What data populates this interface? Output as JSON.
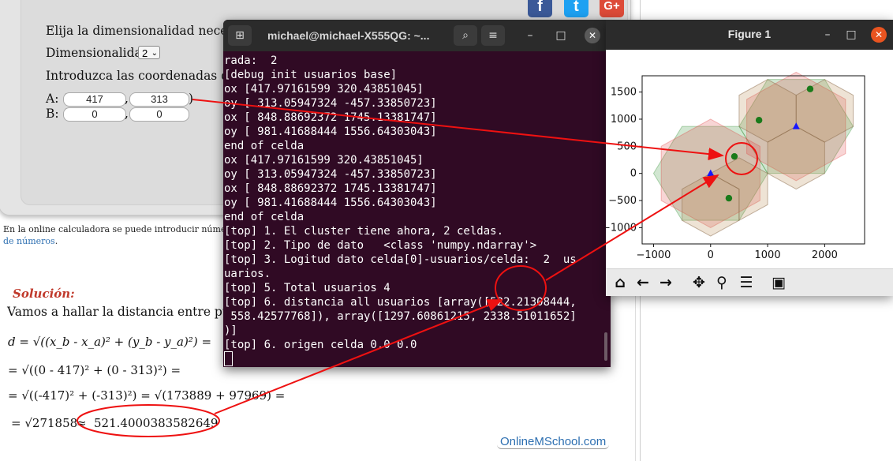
{
  "calculator": {
    "prompt_dimension": "Elija la dimensionalidad necesaria:",
    "dimension_label": "Dimensionalidad:",
    "dimension_value": "2",
    "coords_prompt": "Introduzca las coordenadas de punt",
    "point_a_label": "A: (",
    "point_b_label": "B: (",
    "comma": ",",
    "close_paren": ")",
    "a": [
      "417",
      "313"
    ],
    "b": [
      "0",
      "0"
    ]
  },
  "note": {
    "line1": "En la online calculadora se puede introducir números c",
    "line2": "de números",
    "line2_end": "."
  },
  "social": {
    "facebook": "f",
    "twitter": "t",
    "google": "G+"
  },
  "solution": {
    "title": "Solución:",
    "intro": "Vamos a hallar la distancia entre puntos A(",
    "f1": "d = √((x_b - x_a)² + (y_b - y_a)²) =",
    "f2": "= √((0 - 417)² + (0 - 313)²) =",
    "f3": "= √((-417)² + (-313)²) = √(173889 + 97969) =",
    "f4a": "= √271858",
    "f4b": "≈",
    "result": "521.4000383582649",
    "brand": "OnlineMSchool.com"
  },
  "terminal": {
    "title": "michael@michael-X555QG: ~...",
    "lines": [
      "rada:  2",
      "[debug init usuarios base]",
      "ox [417.97161599 320.43851045]",
      "oy [ 313.05947324 -457.33850723]",
      "ox [ 848.88692372 1745.13381747]",
      "oy [ 981.41688444 1556.64303043]",
      "end of celda",
      "ox [417.97161599 320.43851045]",
      "oy [ 313.05947324 -457.33850723]",
      "ox [ 848.88692372 1745.13381747]",
      "oy [ 981.41688444 1556.64303043]",
      "end of celda",
      "[top] 1. El cluster tiene ahora, 2 celdas.",
      "[top] 2. Tipo de dato   <class 'numpy.ndarray'>",
      "[top] 3. Logitud dato celda[0]-usuarios/celda:  2  us",
      "uarios.",
      "[top] 5. Total usuarios 4",
      "[top] 6. distancia all usuarios [array([522.21308444,",
      " 558.42577768]), array([1297.60861215, 2338.51011652]",
      ")]",
      "[top] 6. origen celda 0.0 0.0"
    ]
  },
  "figure": {
    "title": "Figure 1",
    "toolbar": [
      "home",
      "back",
      "forward",
      "pan",
      "zoom",
      "configure",
      "save"
    ]
  },
  "chart_data": {
    "type": "scatter",
    "title": "",
    "xlabel": "",
    "ylabel": "",
    "xlim": [
      -1200,
      2700
    ],
    "ylim": [
      -1300,
      1800
    ],
    "x_ticks": [
      -1000,
      0,
      1000,
      2000
    ],
    "y_ticks": [
      1500,
      1000,
      500,
      0,
      -500,
      -1000
    ],
    "x_tick_labels": [
      "−1000",
      "0",
      "1000",
      "2000"
    ],
    "y_tick_labels": [
      "1500",
      "1000",
      "500",
      "0",
      "−500",
      "−1000"
    ],
    "grid": false,
    "users": {
      "color": "#1a7a1a",
      "x": [
        417.97,
        320.44,
        848.89,
        1745.13
      ],
      "y": [
        313.06,
        -457.34,
        981.42,
        1556.64
      ]
    },
    "cell_centers": {
      "color": "#1515ff",
      "x": [
        0,
        1500
      ],
      "y": [
        0,
        866
      ]
    },
    "hexagon_colors": {
      "green": "#2e8b2e",
      "red": "#e04040"
    }
  },
  "annotation_color": "#ee1111"
}
